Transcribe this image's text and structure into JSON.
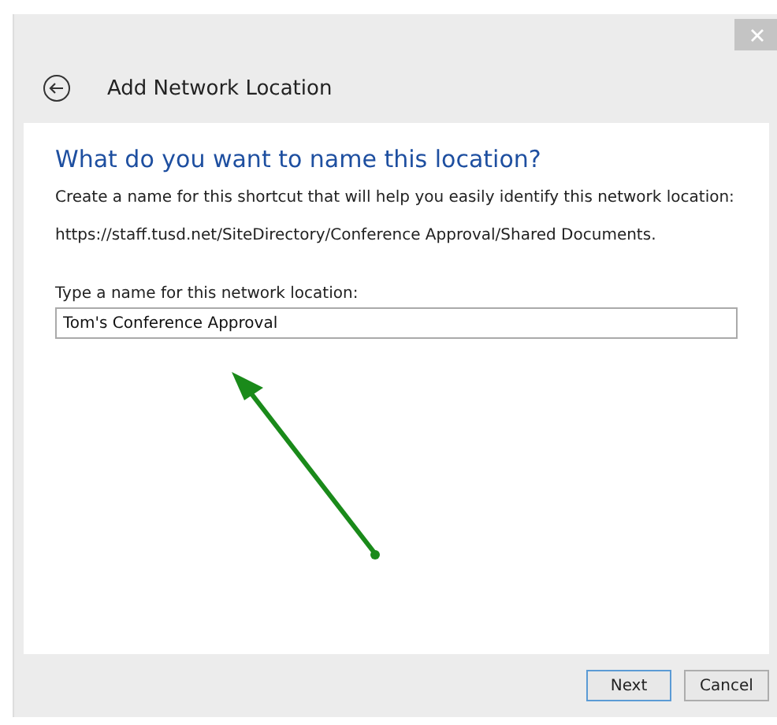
{
  "window": {
    "title": "Add Network Location"
  },
  "heading": "What do you want to name this location?",
  "description": "Create a name for this shortcut that will help you easily identify this network location:",
  "address": "https://staff.tusd.net/SiteDirectory/Conference Approval/Shared Documents.",
  "name_field": {
    "label": "Type a name for this network location:",
    "value": "Tom's Conference Approval"
  },
  "buttons": [
    {
      "label": "Next",
      "kind": "default"
    },
    {
      "label": "Cancel",
      "kind": "normal"
    }
  ]
}
